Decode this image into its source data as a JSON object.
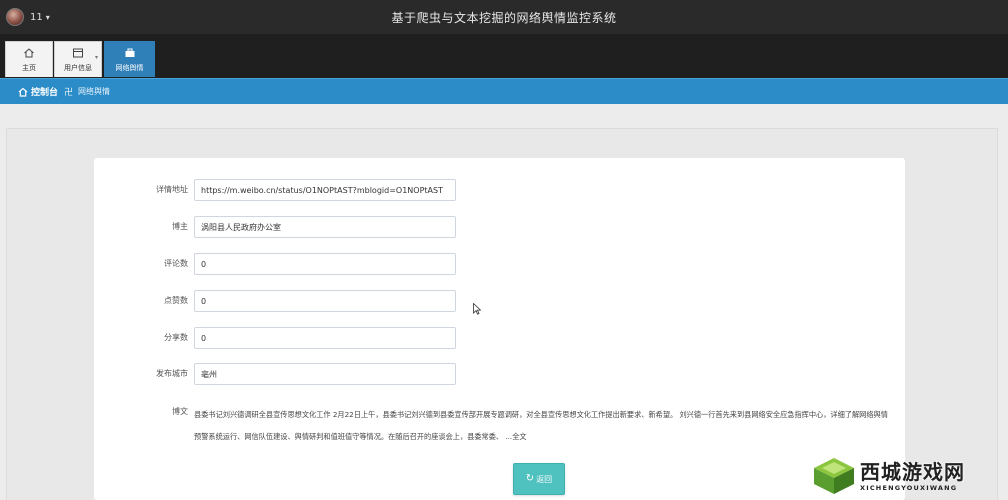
{
  "header": {
    "user_name": "11",
    "user_caret": "▾",
    "app_title": "基于爬虫与文本挖掘的网络舆情监控系统"
  },
  "tabs": [
    {
      "label": "主页",
      "icon": "home-icon",
      "active": false
    },
    {
      "label": "用户信息",
      "icon": "id-card-icon",
      "active": false
    },
    {
      "label": "网络舆情",
      "icon": "briefcase-icon",
      "active": true
    }
  ],
  "breadcrumb": {
    "home": "控制台",
    "separator": "卍",
    "current": "网络舆情"
  },
  "form": {
    "detail_url": {
      "label": "详情地址",
      "value": "https://m.weibo.cn/status/O1NOPtAST?mblogid=O1NOPtAST"
    },
    "blogger": {
      "label": "博主",
      "value": "涡阳县人民政府办公室"
    },
    "comments": {
      "label": "评论数",
      "value": "0"
    },
    "likes": {
      "label": "点赞数",
      "value": "0"
    },
    "shares": {
      "label": "分享数",
      "value": "0"
    },
    "city": {
      "label": "发布城市",
      "value": "亳州"
    },
    "post": {
      "label": "博文",
      "text": "县委书记刘兴德调研全县宣传思想文化工作 2月22日上午，县委书记刘兴德到县委宣传部开展专题调研，对全县宣传思想文化工作提出新要求、新希望。 刘兴德一行首先来到县网络安全应急指挥中心，详细了解网络舆情预警系统运行、网信队伍建设、舆情研判和值班值守等情况。在随后召开的座谈会上，县委常委、 ...全文"
    }
  },
  "back_button": {
    "icon": "↻",
    "label": "返回"
  },
  "watermark": {
    "main": "西城游戏网",
    "sub": "XICHENGYOUXIWANG"
  },
  "colors": {
    "accent_blue": "#2b8cc8",
    "active_tab": "#2f7fb8",
    "button_teal": "#4fc1bf",
    "header_dark": "#2a2a2a"
  }
}
